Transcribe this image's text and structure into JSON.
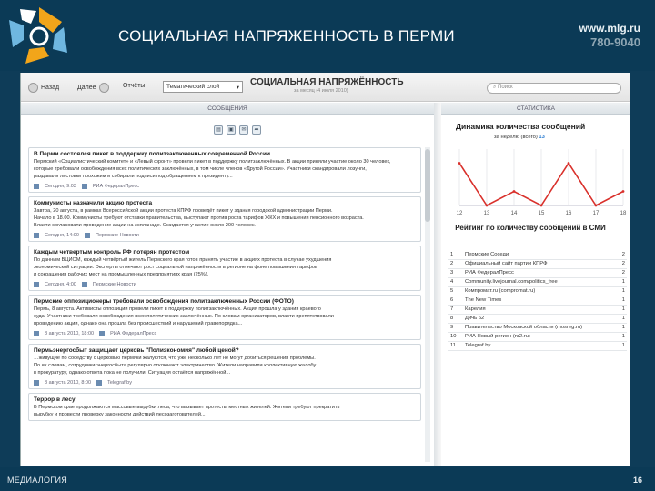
{
  "slide": {
    "title": "СОЦИАЛЬНАЯ НАПРЯЖЕННОСТЬ В ПЕРМИ",
    "site_url": "www.mlg.ru",
    "site_phone": "780-9040",
    "footer_left": "МЕДИАЛОГИЯ",
    "page_number": "16"
  },
  "toolbar": {
    "back_label": "Назад",
    "forward_label": "Далее",
    "reports_label": "Отчёты",
    "theme_value": "Тематический слой",
    "app_title": "СОЦИАЛЬНАЯ НАПРЯЖЁННОСТЬ",
    "app_subtitle": "за месяц (4 июля 2010)",
    "search_placeholder": "Поиск"
  },
  "panels": {
    "messages_head": "СООБЩЕНИЯ",
    "stats_head": "СТАТИСТИКА"
  },
  "messages": [
    {
      "title": "В Перми состоялся пикет в поддержку политзаключенных современной России",
      "lines": [
        "Пермский «Социалистический комитет» и «Левый фронт» провели пикет в поддержку политзаключённых. В акции приняли участие около 30 человек,",
        "которые требовали освобождения всех политических заключённых, в том числе членов «Другой России». Участники скандировали лозунги,",
        "раздавали листовки прохожим и собирали подписи под обращением к президенту..."
      ],
      "date": "Сегодня, 9:03",
      "source": "РИА ФедералПресс"
    },
    {
      "title": "Коммунисты назначили акцию протеста",
      "lines": [
        "Завтра, 20 августа, в рамках Всероссийской акции протеста КПРФ проведёт пикет у здания городской администрации Перми.",
        "Начало в 18.00. Коммунисты требуют отставки правительства, выступают против роста тарифов ЖКХ и повышения пенсионного возраста.",
        "Власти согласовали проведение акции на эспланаде. Ожидается участие около 200 человек."
      ],
      "date": "Сегодня, 14:00",
      "source": "Пермские Новости"
    },
    {
      "title": "Каждым четвертым контроль РФ потерян протестом",
      "lines": [
        "По данным ВЦИОМ, каждый четвёртый житель Пермского края готов принять участие в акциях протеста в случае ухудшения",
        "экономической ситуации. Эксперты отмечают рост социальной напряжённости в регионе на фоне повышения тарифов",
        "и сокращения рабочих мест на промышленных предприятиях края (25%)."
      ],
      "date": "Сегодня, 4:00",
      "source": "Пермские Новости"
    },
    {
      "title": "Пермские оппозиционеры требовали освобождения политзаключенных России (ФОТО)",
      "lines": [
        "Пермь, 8 августа. Активисты оппозиции провели пикет в поддержку политзаключённых. Акция прошла у здания краевого",
        "суда. Участники требовали освобождения всех политических заключённых. По словам организаторов, власти препятствовали",
        "проведению акции, однако она прошла без происшествий и нарушений правопорядка..."
      ],
      "date": "8 августа 2010, 18:00",
      "source": "РИА ФедералПресс"
    },
    {
      "title": "Пермьэнергосбыт защищает церковь \"Полиэкономия\" любой ценой?",
      "lines": [
        "…живущие по соседству с церковью пермяки жалуются, что уже несколько лет не могут добиться решения проблемы.",
        "По их словам, сотрудники энергосбыта регулярно отключают электричество. Жители направили коллективную жалобу",
        "в прокуратуру, однако ответа пока не получили. Ситуация остаётся напряжённой..."
      ],
      "date": "8 августа 2010, 8:00",
      "source": "Telegraf.by"
    },
    {
      "title": "Террор в лесу",
      "lines": [
        "В Пермском крае продолжаются массовые вырубки леса, что вызывает протесты местных жителей. Жители требуют прекратить",
        "вырубку и провести проверку законности действий лесозаготовителей..."
      ],
      "date": "",
      "source": ""
    }
  ],
  "stats": {
    "chart_title": "Динамика количества сообщений",
    "chart_subtitle_prefix": "за неделю (всего)",
    "chart_total": "13"
  },
  "chart_data": {
    "type": "line",
    "title": "Динамика количества сообщений",
    "x": [
      "12",
      "13",
      "14",
      "15",
      "16",
      "17",
      "18"
    ],
    "values": [
      3,
      0,
      1,
      0,
      3,
      0,
      1
    ],
    "ylim": [
      0,
      4
    ],
    "grid": true,
    "color": "#d9302b"
  },
  "ranking": {
    "title": "Рейтинг по количеству сообщений в СМИ",
    "rows": [
      {
        "n": "1",
        "name": "Пермские Соседи",
        "count": "2"
      },
      {
        "n": "2",
        "name": "Официальный сайт партии КПРФ",
        "count": "2"
      },
      {
        "n": "3",
        "name": "РИА ФедералПресс",
        "count": "2"
      },
      {
        "n": "4",
        "name": "Community.livejournal.com/politics_free",
        "count": "1"
      },
      {
        "n": "5",
        "name": "Компромат.ru (compromat.ru)",
        "count": "1"
      },
      {
        "n": "6",
        "name": "The New Times",
        "count": "1"
      },
      {
        "n": "7",
        "name": "Карелия",
        "count": "1"
      },
      {
        "n": "8",
        "name": "Дичь 62",
        "count": "1"
      },
      {
        "n": "9",
        "name": "Правительство Московской области (mosreg.ru)",
        "count": "1"
      },
      {
        "n": "10",
        "name": "РИА Новый регион (nr2.ru)",
        "count": "1"
      },
      {
        "n": "11",
        "name": "Telegraf.by",
        "count": "1"
      }
    ]
  }
}
